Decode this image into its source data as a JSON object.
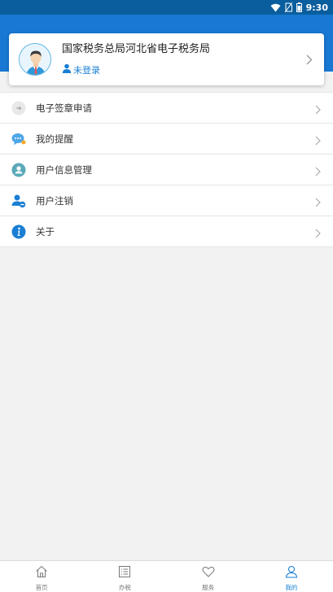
{
  "status_bar": {
    "time": "9:30"
  },
  "profile": {
    "agency_name": "国家税务总局河北省电子税务局",
    "login_status": "未登录"
  },
  "menu": {
    "items": [
      {
        "label": "电子签章申请",
        "icon": "stamp-icon"
      },
      {
        "label": "我的提醒",
        "icon": "chat-bubble-icon"
      },
      {
        "label": "用户信息管理",
        "icon": "user-info-icon"
      },
      {
        "label": "用户注销",
        "icon": "user-remove-icon"
      },
      {
        "label": "关于",
        "icon": "info-icon"
      }
    ]
  },
  "bottom_nav": {
    "items": [
      {
        "label": "首页",
        "icon": "home-icon"
      },
      {
        "label": "办税",
        "icon": "list-icon"
      },
      {
        "label": "服务",
        "icon": "heart-icon"
      },
      {
        "label": "我的",
        "icon": "person-icon"
      }
    ],
    "active": "我的"
  },
  "colors": {
    "header": "#1878d3",
    "status_bar": "#0b5e9e",
    "accent": "#1a7fd4",
    "background": "#f2f2f2"
  }
}
